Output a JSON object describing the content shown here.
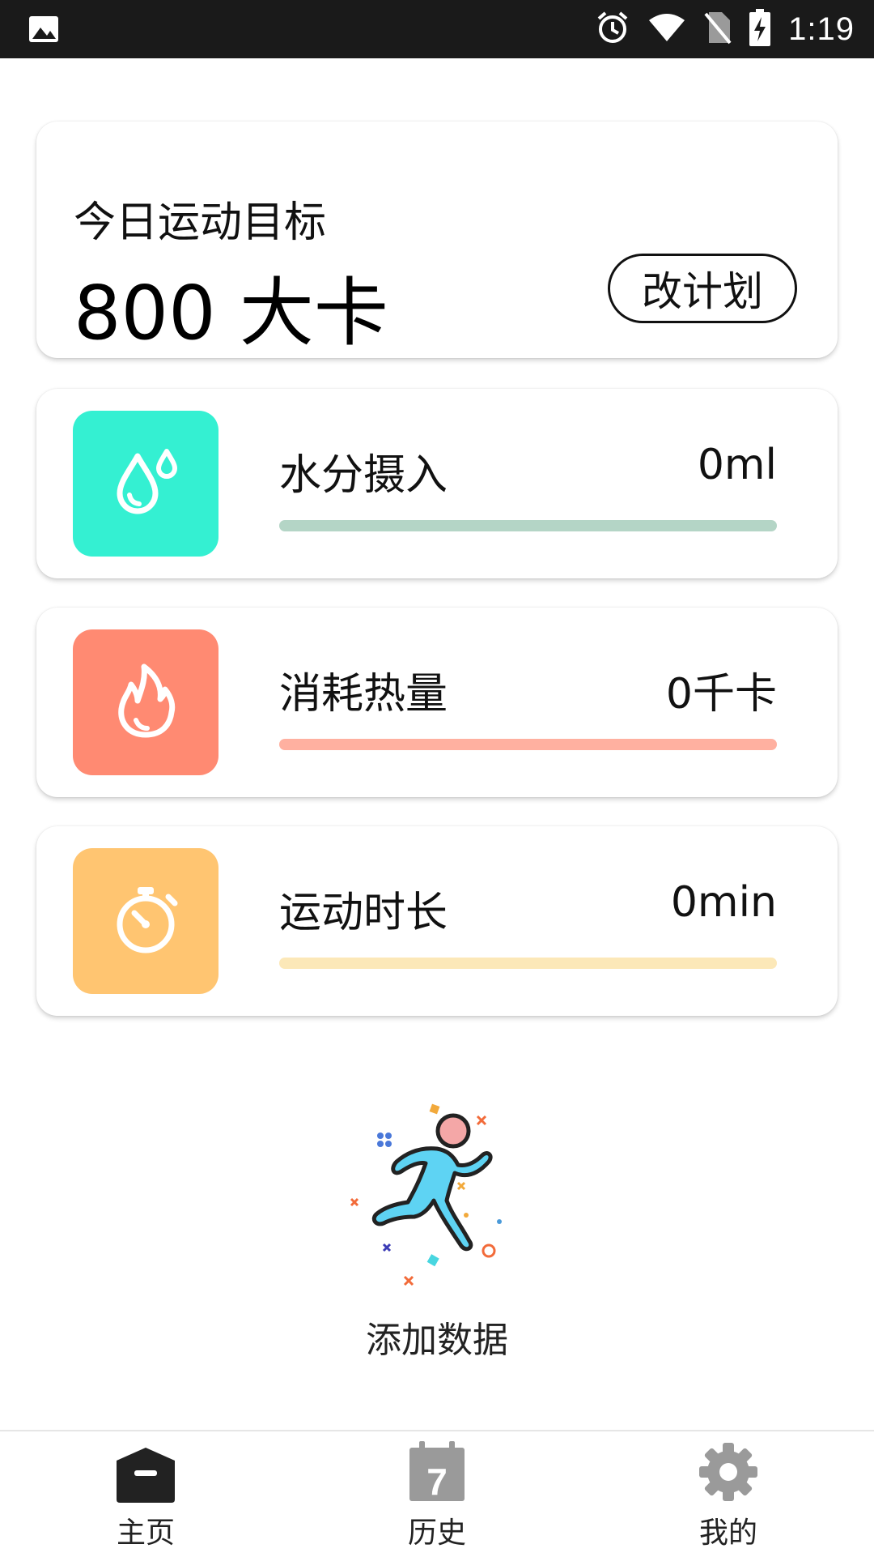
{
  "status_bar": {
    "time": "1:19",
    "icons": [
      "image-icon",
      "alarm-icon",
      "wifi-icon",
      "no-sim-icon",
      "battery-charging-icon"
    ]
  },
  "goal": {
    "title": "今日运动目标",
    "value": "800 大卡",
    "button_label": "改计划"
  },
  "stats": [
    {
      "label": "水分摄入",
      "value": "0ml",
      "icon": "water-drop-icon",
      "icon_bg": "#34F0D2",
      "track_color": "#B4D5C6",
      "progress": 0
    },
    {
      "label": "消耗热量",
      "value": "0千卡",
      "icon": "flame-icon",
      "icon_bg": "#FF8A72",
      "track_color": "#FFB0A0",
      "progress": 0
    },
    {
      "label": "运动时长",
      "value": "0min",
      "icon": "stopwatch-icon",
      "icon_bg": "#FFC571",
      "track_color": "#FCE8B8",
      "progress": 0
    }
  ],
  "add_data": {
    "label": "添加数据",
    "icon": "running-person-icon"
  },
  "nav": {
    "items": [
      {
        "label": "主页",
        "icon": "home-icon",
        "active": true
      },
      {
        "label": "历史",
        "icon": "calendar-icon",
        "calendar_day": "7"
      },
      {
        "label": "我的",
        "icon": "gear-icon"
      }
    ]
  }
}
